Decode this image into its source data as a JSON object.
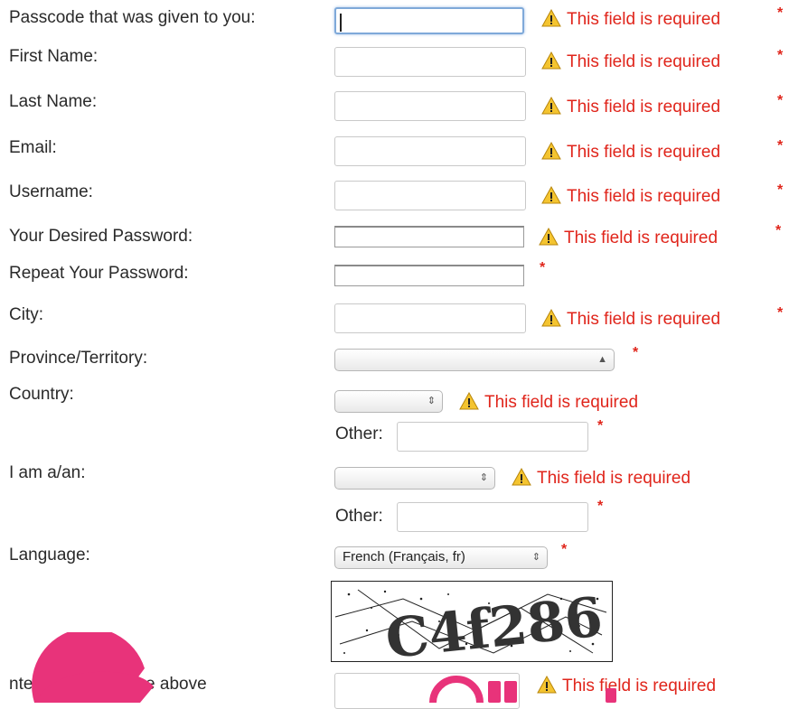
{
  "form": {
    "fields": [
      {
        "label": "Passcode that was given to you:",
        "error": "This field is required"
      },
      {
        "label": "First Name:",
        "error": "This field is required"
      },
      {
        "label": "Last Name:",
        "error": "This field is required"
      },
      {
        "label": "Email:",
        "error": "This field is required"
      },
      {
        "label": "Username:",
        "error": "This field is required"
      },
      {
        "label": "Your Desired Password:",
        "error": "This field is required"
      },
      {
        "label": "Repeat Your Password:"
      },
      {
        "label": "City:",
        "error": "This field is required"
      },
      {
        "label": "Province/Territory:"
      },
      {
        "label": "Country:",
        "error": "This field is required",
        "other_label": "Other:"
      },
      {
        "label": "I am a/an:",
        "error": "This field is required",
        "other_label": "Other:"
      },
      {
        "label": "Language:",
        "selected": "French (Français, fr)"
      }
    ],
    "required_mark": "*",
    "captcha": {
      "label": "nter the co   you see above",
      "text": "C4f286",
      "error": "This field is required"
    }
  },
  "colors": {
    "error": "#e0251b",
    "focus_border": "#7fa9d9",
    "overlay": "#e8337a"
  }
}
